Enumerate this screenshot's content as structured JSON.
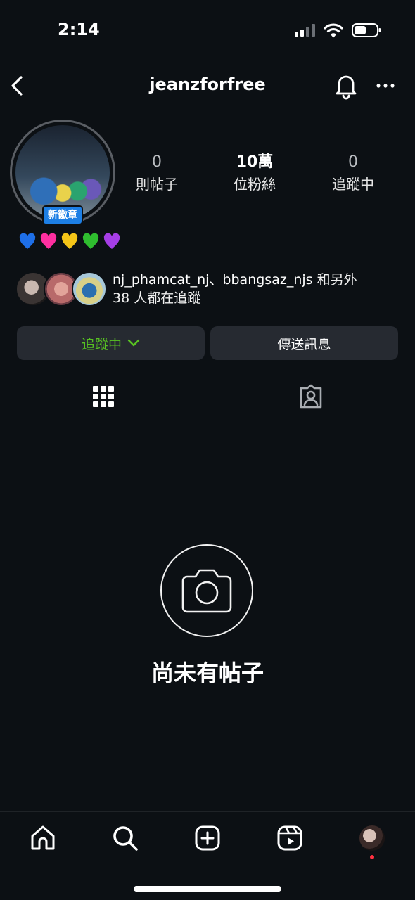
{
  "status_bar": {
    "time": "2:14"
  },
  "header": {
    "username": "jeanzforfree"
  },
  "profile": {
    "badge": "新徽章",
    "hearts": [
      "blue-heart",
      "pink-heart",
      "yellow-heart",
      "green-heart",
      "purple-heart"
    ],
    "heart_colors": [
      "#1e6fe8",
      "#ff2fa0",
      "#f5c518",
      "#2fbd2f",
      "#a63ee6"
    ]
  },
  "stats": {
    "posts": {
      "value": "0",
      "label": "則帖子"
    },
    "followers": {
      "value": "10萬",
      "label": "位粉絲"
    },
    "following": {
      "value": "0",
      "label": "追蹤中"
    }
  },
  "followed_by": {
    "line1_names": "nj_phamcat_nj、bbangsaz_njs",
    "line1_suffix": "和另外",
    "line2": "38 人都在追蹤"
  },
  "actions": {
    "follow_label": "追蹤中",
    "message_label": "傳送訊息",
    "follow_color": "#58c322"
  },
  "empty_state": {
    "text": "尚未有帖子"
  },
  "nav": {
    "items": [
      "home-icon",
      "search-icon",
      "create-icon",
      "reels-icon",
      "profile-avatar"
    ]
  }
}
